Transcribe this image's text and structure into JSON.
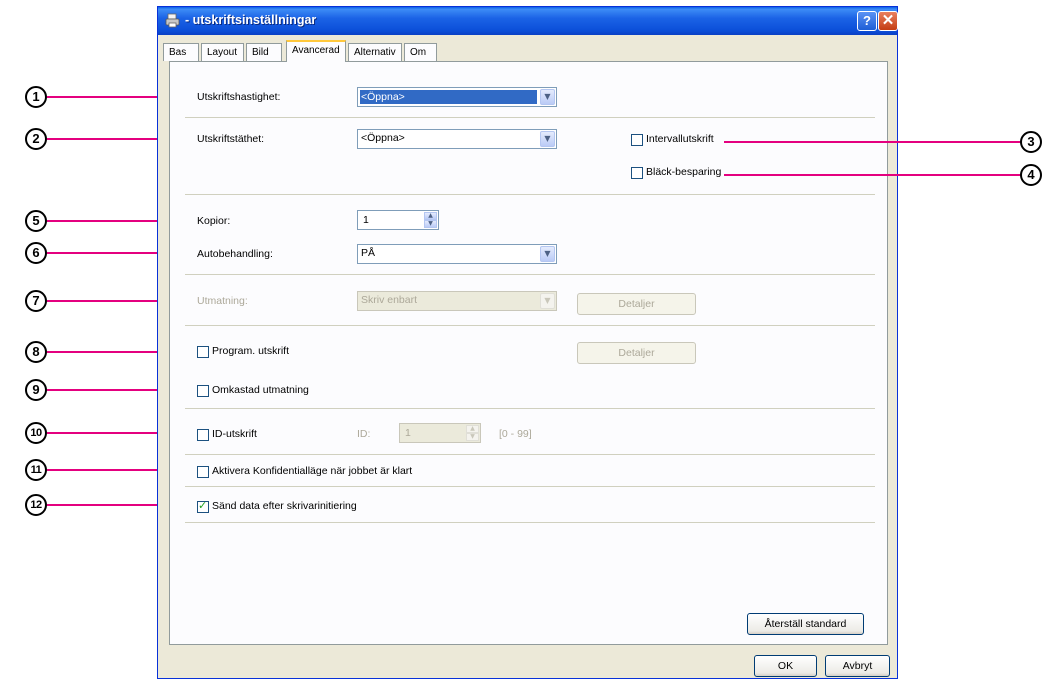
{
  "window": {
    "title": "- utskriftsinställningar",
    "help_glyph": "?",
    "close_glyph": "✕"
  },
  "tabs": [
    {
      "label": "Bas"
    },
    {
      "label": "Layout"
    },
    {
      "label": "Bild"
    },
    {
      "label": "Avancerad",
      "active": true
    },
    {
      "label": "Alternativ"
    },
    {
      "label": "Om"
    }
  ],
  "settings": {
    "speed": {
      "label": "Utskriftshastighet:",
      "value": "<Öppna>"
    },
    "density": {
      "label": "Utskriftstäthet:",
      "value": "<Öppna>"
    },
    "interval": {
      "label": "Intervallutskrift",
      "checked": false
    },
    "ink_saving": {
      "label": "Bläck-besparing",
      "checked": false
    },
    "copies": {
      "label": "Kopior:",
      "value": "1"
    },
    "auto": {
      "label": "Autobehandling:",
      "value": "PÅ"
    },
    "output": {
      "label": "Utmatning:",
      "value": "Skriv enbart",
      "details": "Detaljer"
    },
    "program": {
      "label": "Program. utskrift",
      "checked": false,
      "details": "Detaljer"
    },
    "reverse": {
      "label": "Omkastad utmatning",
      "checked": false
    },
    "id_print": {
      "label": "ID-utskrift",
      "checked": false,
      "id_label": "ID:",
      "id_value": "1",
      "range": "[0 - 99]"
    },
    "confidential": {
      "label": "Aktivera Konfidentialläge när jobbet är klart",
      "checked": false
    },
    "send_after_init": {
      "label": "Sänd data efter skrivarinitiering",
      "checked": true
    }
  },
  "buttons": {
    "reset": "Återställ standard",
    "ok": "OK",
    "cancel": "Avbryt"
  },
  "callouts": [
    "1",
    "2",
    "3",
    "4",
    "5",
    "6",
    "7",
    "8",
    "9",
    "10",
    "11",
    "12"
  ],
  "colors": {
    "callout_line": "#e4007f",
    "title_bar": "#0b4ed8",
    "selection": "#316ac5"
  }
}
